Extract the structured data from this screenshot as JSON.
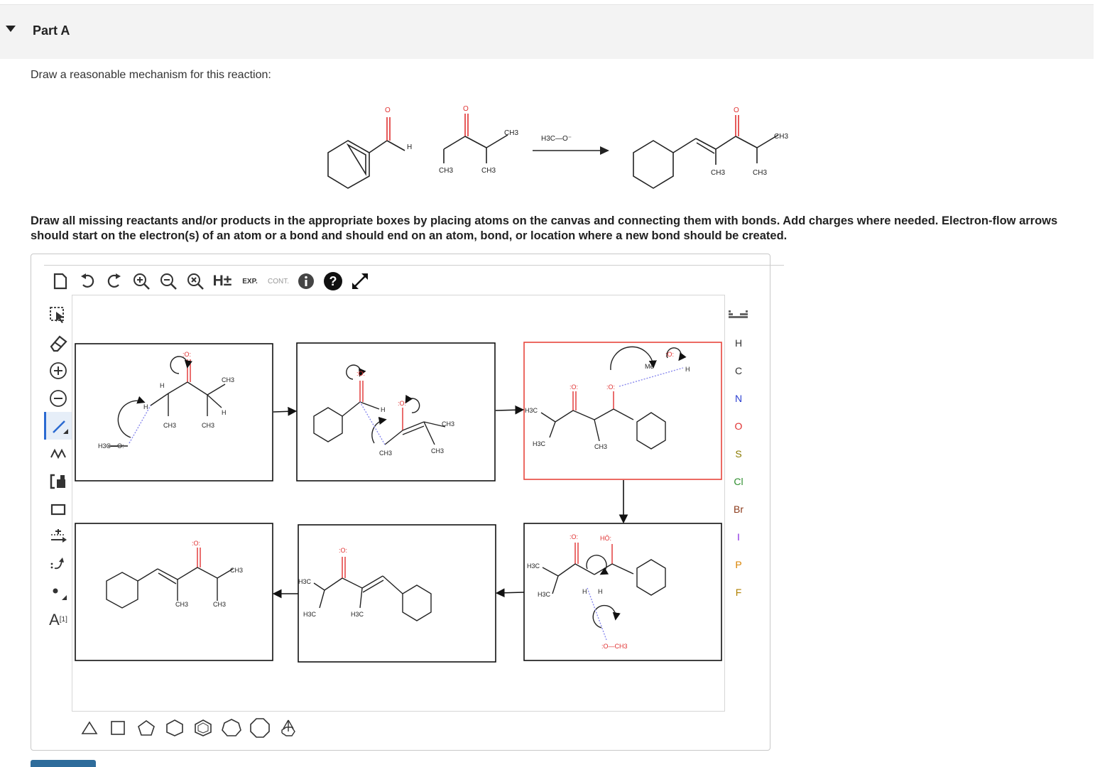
{
  "part": {
    "title": "Part A"
  },
  "question": {
    "prompt": "Draw a reasonable mechanism for this reaction:",
    "instructions": "Draw all missing reactants and/or products in the appropriate boxes by placing atoms on the canvas and connecting them with bonds. Add charges where needed. Electron-flow arrows should start on the electron(s) of an atom or a bond and should end on an atom, bond, or location where a new bond should be created."
  },
  "reaction": {
    "reagent": "H3C—O⁻",
    "labels": {
      "ch3": "CH3",
      "h": "H",
      "o": "O"
    }
  },
  "toolbar": {
    "top": [
      {
        "name": "new-document-icon"
      },
      {
        "name": "undo-icon"
      },
      {
        "name": "redo-icon"
      },
      {
        "name": "zoom-in-icon"
      },
      {
        "name": "zoom-out-icon"
      },
      {
        "name": "zoom-reset-icon"
      },
      {
        "name": "h-toggle-icon",
        "label": "H±"
      },
      {
        "name": "expand-label-icon",
        "label": "EXP."
      },
      {
        "name": "contract-label-icon",
        "label": "CONT."
      },
      {
        "name": "info-icon"
      },
      {
        "name": "help-icon"
      },
      {
        "name": "fullscreen-icon"
      }
    ],
    "left": [
      {
        "name": "selection-tool-icon"
      },
      {
        "name": "eraser-icon"
      },
      {
        "name": "positive-charge-icon"
      },
      {
        "name": "negative-charge-icon"
      },
      {
        "name": "single-bond-icon"
      },
      {
        "name": "chain-tool-icon"
      },
      {
        "name": "template-icon"
      },
      {
        "name": "box-tool-icon"
      },
      {
        "name": "reaction-arrow-icon"
      },
      {
        "name": "electron-flow-arrow-icon"
      },
      {
        "name": "radical-icon"
      },
      {
        "name": "atom-label-icon",
        "label": "A",
        "sup": "[1]"
      }
    ],
    "elements": [
      {
        "symbol": "H",
        "color": "#333333"
      },
      {
        "symbol": "C",
        "color": "#333333"
      },
      {
        "symbol": "N",
        "color": "#2b3fd1"
      },
      {
        "symbol": "O",
        "color": "#e03131"
      },
      {
        "symbol": "S",
        "color": "#8a7a00"
      },
      {
        "symbol": "Cl",
        "color": "#2f8f2f"
      },
      {
        "symbol": "Br",
        "color": "#8b3a1a"
      },
      {
        "symbol": "I",
        "color": "#8a2be2"
      },
      {
        "symbol": "P",
        "color": "#d98200"
      },
      {
        "symbol": "F",
        "color": "#b08000"
      }
    ],
    "shapes": [
      "triangle-icon",
      "square-icon",
      "pentagon-icon",
      "hexagon-icon",
      "benzene-icon",
      "heptagon-icon",
      "octagon-icon",
      "bicyclic-icon"
    ]
  },
  "canvas": {
    "labels": {
      "ch3": "CH3",
      "h3c": "H3C",
      "h": "H",
      "me": "Me",
      "o_lone": ":O:",
      "o_ho": "HÖ:",
      "o_neg": ":O:",
      "reagent": "H3C—O:",
      "methoxy": ":O—CH3"
    }
  }
}
